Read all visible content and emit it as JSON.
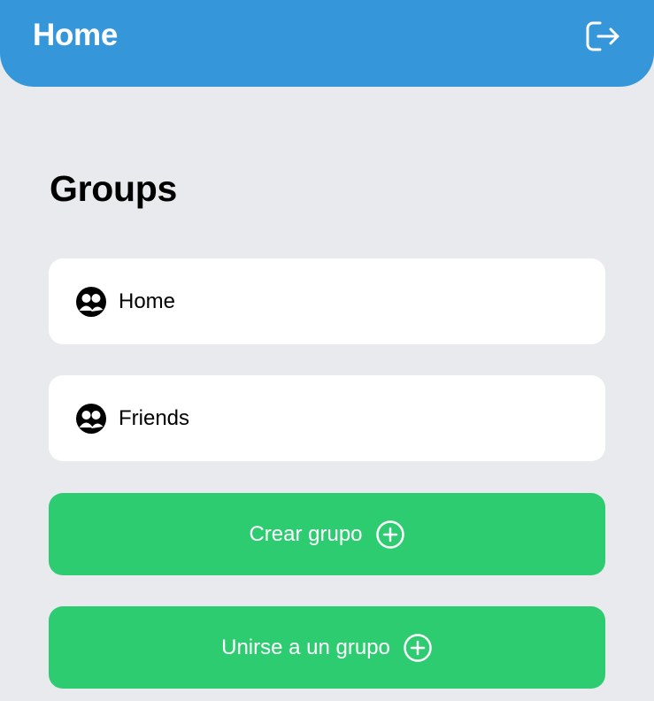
{
  "header": {
    "title": "Home",
    "logout_icon": "logout-icon"
  },
  "main": {
    "section_title": "Groups",
    "groups": [
      {
        "label": "Home",
        "icon": "group-icon"
      },
      {
        "label": "Friends",
        "icon": "group-icon"
      }
    ],
    "actions": [
      {
        "label": "Crear grupo",
        "icon": "plus-circle-icon"
      },
      {
        "label": "Unirse a un grupo",
        "icon": "plus-circle-icon"
      }
    ]
  },
  "colors": {
    "header_bg": "#3597da",
    "page_bg": "#e9eaed",
    "card_bg": "#ffffff",
    "action_bg": "#2ecc71"
  }
}
